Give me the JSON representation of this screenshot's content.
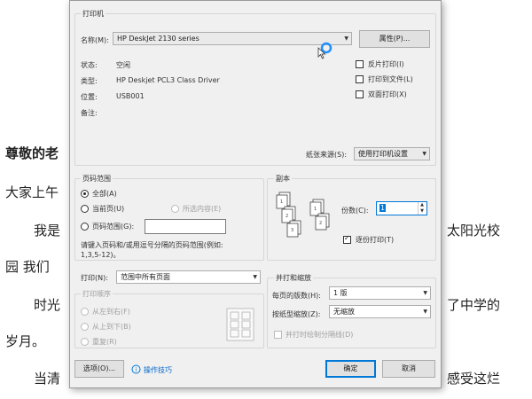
{
  "document": {
    "salutation": "尊敬的老",
    "line1": "大家上午",
    "line2_left": "我是",
    "line2_right": "太阳光校",
    "line3_left": "园 我们",
    "line4_left": "时光",
    "line4_right": "了中学的",
    "line5_left": "岁月。",
    "line6_left": "当清",
    "line6_right": "感受这烂"
  },
  "printer": {
    "group_title": "打印机",
    "name_label": "名称(M):",
    "name_value": "HP DeskJet 2130 series",
    "properties_button": "属性(P)...",
    "status_label": "状态:",
    "status_value": "空闲",
    "type_label": "类型:",
    "type_value": "HP Deskjet PCL3 Class Driver",
    "location_label": "位置:",
    "location_value": "USB001",
    "comment_label": "备注:",
    "reverse_print": "反片打印(I)",
    "print_to_file": "打印到文件(L)",
    "duplex": "双面打印(X)",
    "paper_source_label": "纸张来源(S):",
    "paper_source_value": "使用打印机设置"
  },
  "page_range": {
    "title": "页码范围",
    "all": "全部(A)",
    "current": "当前页(U)",
    "selection": "所选内容(E)",
    "pages": "页码范围(G):",
    "hint_line1": "请键入页码和/或用逗号分隔的页码范围(例如:",
    "hint_line2": "1,3,5-12)。"
  },
  "copies": {
    "title": "副本",
    "count_label": "份数(C):",
    "count_value": "1",
    "collate": "逐份打印(T)"
  },
  "print_what": {
    "label": "打印(N):",
    "value": "范围中所有页面"
  },
  "print_order": {
    "title": "打印顺序",
    "left_to_right": "从左到右(F)",
    "top_to_bottom": "从上到下(B)",
    "repeat": "重复(R)"
  },
  "zoom": {
    "title": "并打和缩放",
    "pages_per_sheet_label": "每页的版数(H):",
    "pages_per_sheet_value": "1 版",
    "scale_label": "按纸型缩放(Z):",
    "scale_value": "无缩放",
    "split_checkbox": "并打时绘制分隔线(D)"
  },
  "footer": {
    "options_button": "选项(O)...",
    "tips_link": "操作技巧",
    "ok_button": "确定",
    "cancel_button": "取消"
  },
  "colors": {
    "accent": "#0078d7",
    "cursor_ring": "#1e90ff"
  }
}
